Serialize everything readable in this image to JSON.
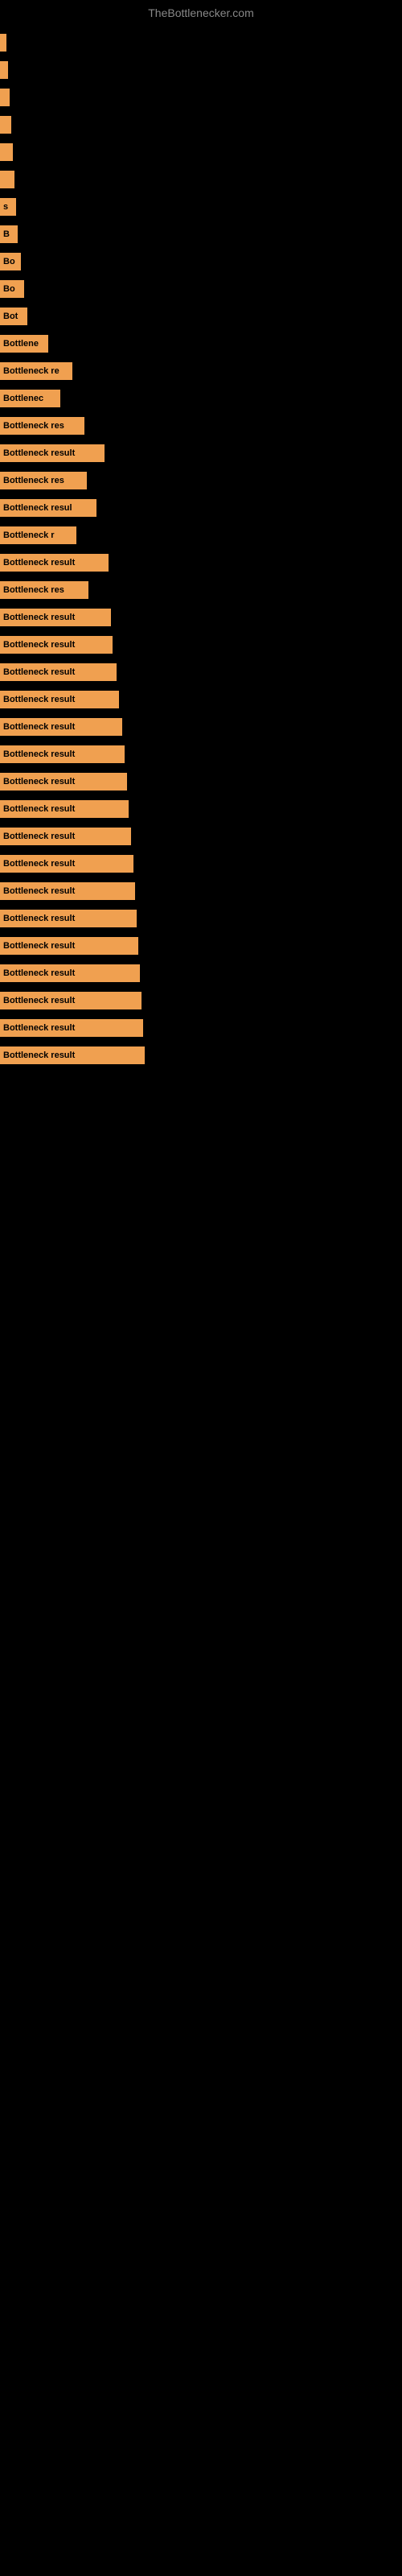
{
  "site": {
    "title": "TheBottlenecker.com"
  },
  "bars": [
    {
      "id": 1,
      "label": "",
      "width": 8
    },
    {
      "id": 2,
      "label": "",
      "width": 10
    },
    {
      "id": 3,
      "label": "",
      "width": 12
    },
    {
      "id": 4,
      "label": "",
      "width": 14
    },
    {
      "id": 5,
      "label": "",
      "width": 16
    },
    {
      "id": 6,
      "label": "",
      "width": 18
    },
    {
      "id": 7,
      "label": "s",
      "width": 20
    },
    {
      "id": 8,
      "label": "B",
      "width": 22
    },
    {
      "id": 9,
      "label": "Bo",
      "width": 26
    },
    {
      "id": 10,
      "label": "Bo",
      "width": 30
    },
    {
      "id": 11,
      "label": "Bot",
      "width": 34
    },
    {
      "id": 12,
      "label": "Bottlene",
      "width": 60
    },
    {
      "id": 13,
      "label": "Bottleneck re",
      "width": 90
    },
    {
      "id": 14,
      "label": "Bottlenec",
      "width": 75
    },
    {
      "id": 15,
      "label": "Bottleneck res",
      "width": 105
    },
    {
      "id": 16,
      "label": "Bottleneck result",
      "width": 130
    },
    {
      "id": 17,
      "label": "Bottleneck res",
      "width": 108
    },
    {
      "id": 18,
      "label": "Bottleneck resul",
      "width": 120
    },
    {
      "id": 19,
      "label": "Bottleneck r",
      "width": 95
    },
    {
      "id": 20,
      "label": "Bottleneck result",
      "width": 135
    },
    {
      "id": 21,
      "label": "Bottleneck res",
      "width": 110
    },
    {
      "id": 22,
      "label": "Bottleneck result",
      "width": 138
    },
    {
      "id": 23,
      "label": "Bottleneck result",
      "width": 140
    },
    {
      "id": 24,
      "label": "Bottleneck result",
      "width": 145
    },
    {
      "id": 25,
      "label": "Bottleneck result",
      "width": 148
    },
    {
      "id": 26,
      "label": "Bottleneck result",
      "width": 152
    },
    {
      "id": 27,
      "label": "Bottleneck result",
      "width": 155
    },
    {
      "id": 28,
      "label": "Bottleneck result",
      "width": 158
    },
    {
      "id": 29,
      "label": "Bottleneck result",
      "width": 160
    },
    {
      "id": 30,
      "label": "Bottleneck result",
      "width": 163
    },
    {
      "id": 31,
      "label": "Bottleneck result",
      "width": 166
    },
    {
      "id": 32,
      "label": "Bottleneck result",
      "width": 168
    },
    {
      "id": 33,
      "label": "Bottleneck result",
      "width": 170
    },
    {
      "id": 34,
      "label": "Bottleneck result",
      "width": 172
    },
    {
      "id": 35,
      "label": "Bottleneck result",
      "width": 174
    },
    {
      "id": 36,
      "label": "Bottleneck result",
      "width": 176
    },
    {
      "id": 37,
      "label": "Bottleneck result",
      "width": 178
    },
    {
      "id": 38,
      "label": "Bottleneck result",
      "width": 180
    }
  ]
}
